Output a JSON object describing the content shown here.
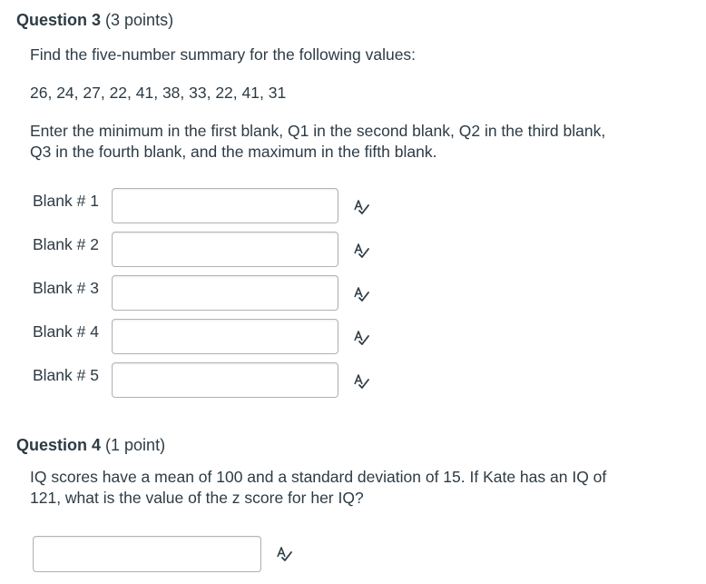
{
  "question3": {
    "title_number": "Question 3",
    "title_points": "(3 points)",
    "prompt": "Find the five-number summary for the following values:",
    "values_text": "26, 24, 27, 22, 41, 38, 33, 22, 41, 31",
    "instructions_line1": "Enter the minimum in the first blank, Q1 in the second blank, Q2 in the third blank,",
    "instructions_line2": "Q3 in the fourth blank, and the maximum in the fifth blank.",
    "blanks": [
      {
        "label": "Blank # 1",
        "value": ""
      },
      {
        "label": "Blank # 2",
        "value": ""
      },
      {
        "label": "Blank # 3",
        "value": ""
      },
      {
        "label": "Blank # 4",
        "value": ""
      },
      {
        "label": "Blank # 5",
        "value": ""
      }
    ]
  },
  "question4": {
    "title_number": "Question 4",
    "title_points": "(1 point)",
    "prompt_line1": "IQ scores have a mean of 100 and a standard deviation of 15. If Kate has an IQ of",
    "prompt_line2": "121, what is the value of the z score for her IQ?",
    "answer_value": ""
  },
  "icons": {
    "spellcheck": "spell-check-icon"
  }
}
